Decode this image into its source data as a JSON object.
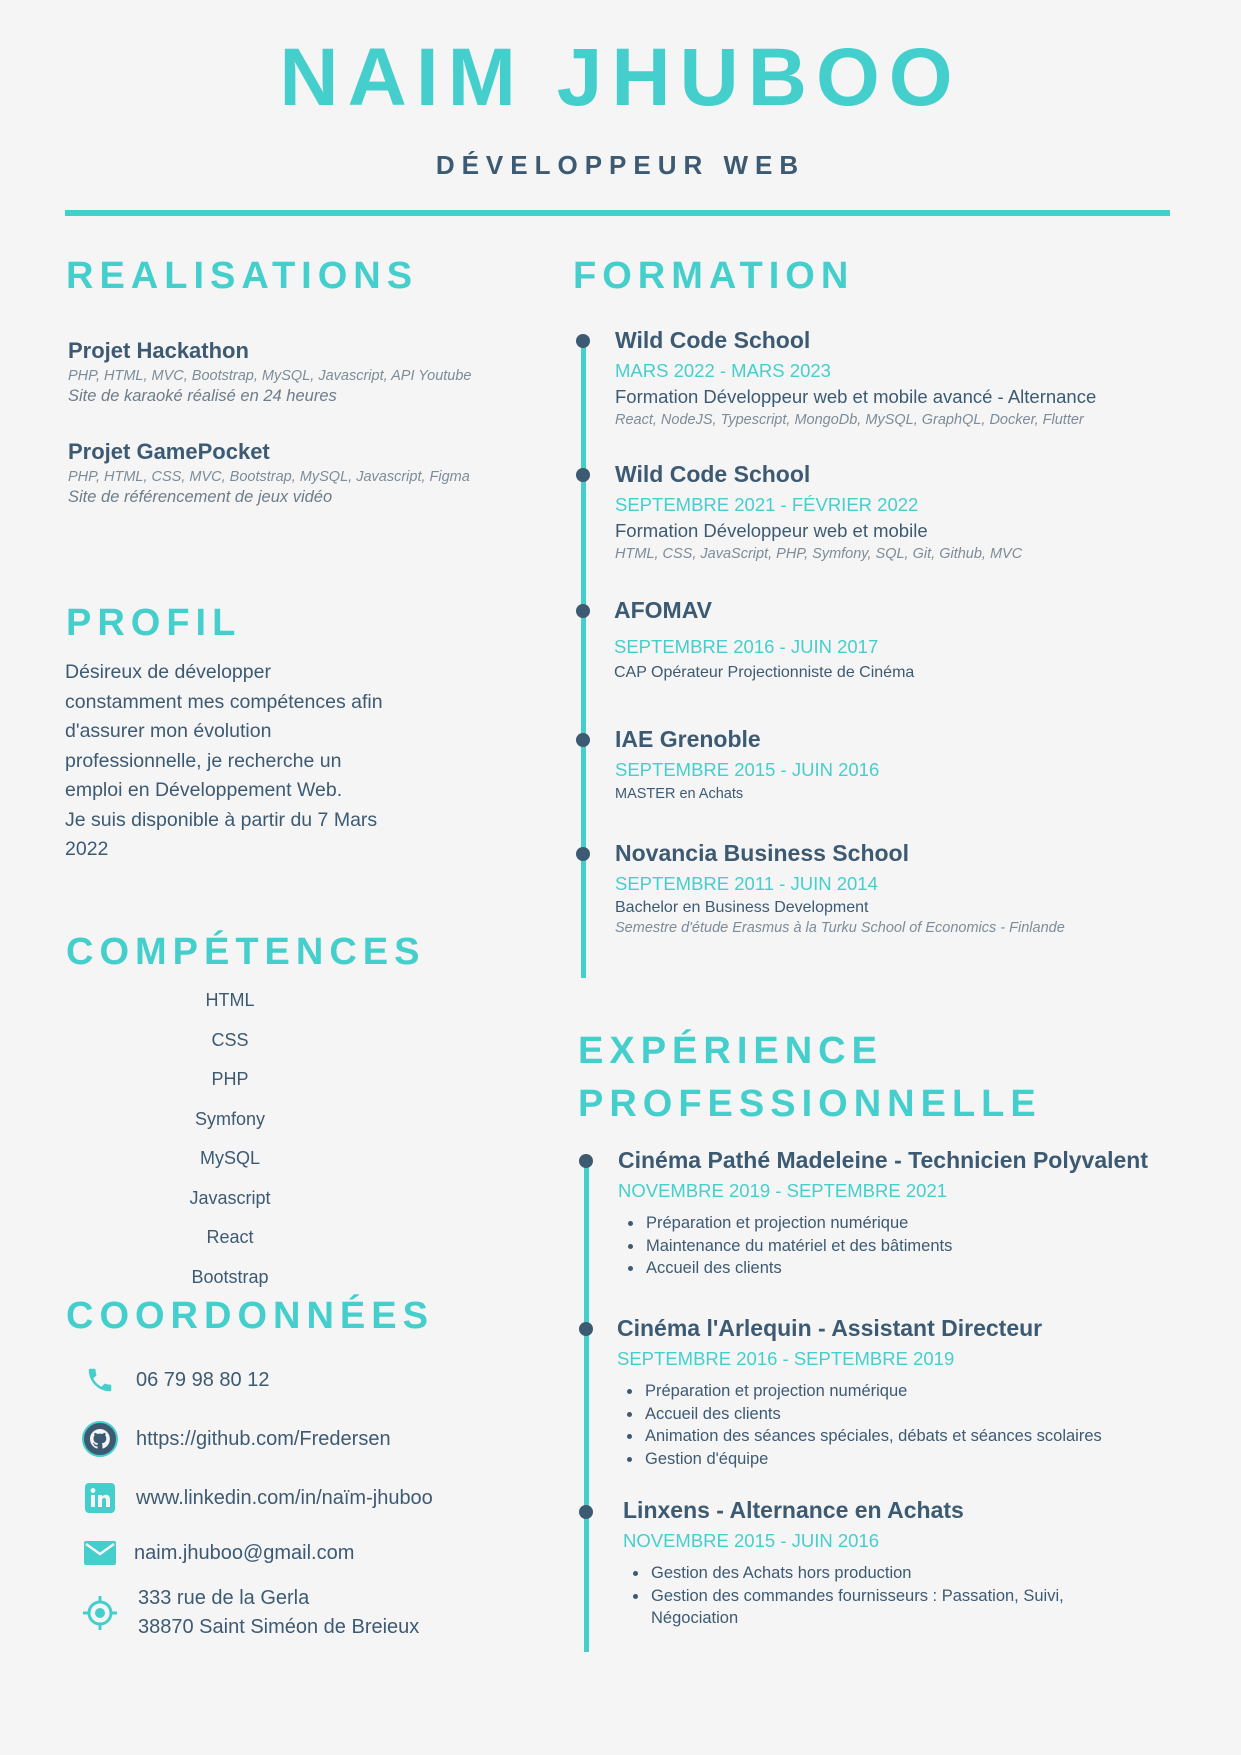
{
  "header": {
    "name": "NAIM JHUBOO",
    "title": "DÉVELOPPEUR WEB"
  },
  "realisations": {
    "heading": "REALISATIONS",
    "items": [
      {
        "title": "Projet Hackathon",
        "tech": "PHP, HTML, MVC, Bootstrap, MySQL, Javascript, API Youtube",
        "desc": "Site de karaoké réalisé en 24 heures"
      },
      {
        "title": "Projet GamePocket",
        "tech": "PHP, HTML, CSS, MVC, Bootstrap, MySQL, Javascript, Figma",
        "desc": "Site de référencement de jeux vidéo"
      }
    ]
  },
  "profil": {
    "heading": "PROFIL",
    "lines": [
      "Désireux de développer",
      "constamment mes compétences afin",
      "d'assurer mon évolution",
      "professionnelle, je recherche un",
      "emploi en Développement Web.",
      "Je suis disponible à partir du 7 Mars",
      "2022"
    ]
  },
  "competences": {
    "heading": "COMPÉTENCES",
    "items": [
      "HTML",
      "CSS",
      "PHP",
      "Symfony",
      "MySQL",
      "Javascript",
      "React",
      "Bootstrap"
    ]
  },
  "coordonnees": {
    "heading": "COORDONNÉES",
    "phone": "06 79 98 80 12",
    "github": "https://github.com/Fredersen",
    "linkedin": "www.linkedin.com/in/naïm-jhuboo",
    "email": "naim.jhuboo@gmail.com",
    "address_line1": "333 rue de la Gerla",
    "address_line2": "38870 Saint Siméon de Breieux"
  },
  "formation": {
    "heading": "FORMATION",
    "items": [
      {
        "school": "Wild Code School",
        "dates": "MARS 2022 - MARS 2023",
        "diploma": "Formation Développeur web et mobile avancé - Alternance",
        "details": "React, NodeJS, Typescript, MongoDb, MySQL, GraphQL, Docker, Flutter"
      },
      {
        "school": "Wild Code School",
        "dates": "SEPTEMBRE 2021 - FÉVRIER 2022",
        "diploma": "Formation Développeur web et mobile",
        "details": "HTML, CSS, JavaScript, PHP, Symfony, SQL, Git, Github, MVC"
      },
      {
        "school": "AFOMAV",
        "dates": "SEPTEMBRE 2016 - JUIN 2017",
        "diploma": "CAP Opérateur Projectionniste de Cinéma"
      },
      {
        "school": "IAE Grenoble",
        "dates": "SEPTEMBRE 2015 - JUIN 2016",
        "diploma": "MASTER en Achats"
      },
      {
        "school": "Novancia Business School",
        "dates": "SEPTEMBRE 2011 - JUIN 2014",
        "diploma": "Bachelor en Business Development",
        "details": "Semestre d'étude Erasmus à la Turku School of Economics - Finlande"
      }
    ]
  },
  "experience": {
    "heading_line1": "EXPÉRIENCE",
    "heading_line2": "PROFESSIONNELLE",
    "items": [
      {
        "title": "Cinéma Pathé Madeleine - Technicien Polyvalent",
        "dates": "NOVEMBRE 2019 - SEPTEMBRE 2021",
        "bullets": [
          "Préparation et projection numérique",
          "Maintenance du matériel et des bâtiments",
          "Accueil des clients"
        ]
      },
      {
        "title": "Cinéma l'Arlequin - Assistant Directeur",
        "dates": "SEPTEMBRE 2016 - SEPTEMBRE 2019",
        "bullets": [
          "Préparation et projection numérique",
          "Accueil des clients",
          "Animation des séances spéciales, débats et séances scolaires",
          "Gestion d'équipe"
        ]
      },
      {
        "title": "Linxens - Alternance en Achats",
        "dates": "NOVEMBRE 2015 - JUIN 2016",
        "bullets": [
          "Gestion des Achats hors production",
          "Gestion des commandes fournisseurs : Passation, Suivi, Négociation"
        ]
      }
    ]
  },
  "colors": {
    "accent": "#45cfcc",
    "text": "#3d5a73",
    "background": "#f5f5f5"
  }
}
